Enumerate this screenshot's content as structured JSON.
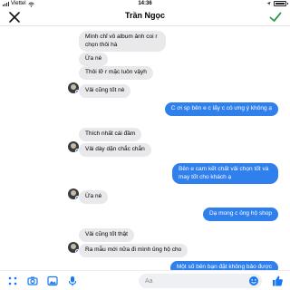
{
  "status_bar": {
    "carrier": "Viettel",
    "time": "14:36",
    "battery_level": 0.8
  },
  "header": {
    "title": "Trần Ngọc"
  },
  "messages": [
    {
      "sender": "contact",
      "text": "Mình chỉ vô album ảnh coi r chọn thôi hà"
    },
    {
      "sender": "contact",
      "text": "Ừa nè"
    },
    {
      "sender": "contact",
      "text": "Thôi lỡ r mặc luôn vậyh"
    },
    {
      "sender": "contact",
      "text": "Vải cũng tốt nè"
    },
    {
      "sender": "me",
      "text": "C ơi sp bên e c lấy c có ưng ý không ạ"
    },
    {
      "sender": "contact",
      "text": "Thích nhất cái đầm"
    },
    {
      "sender": "contact",
      "text": "Vải dày dặn chắc chắn"
    },
    {
      "sender": "me",
      "text": "Bên e cam kết chất vải chọn tốt và may tốt cho khách ạ"
    },
    {
      "sender": "contact",
      "text": "Ừa nè"
    },
    {
      "sender": "me",
      "text": "Dạ mong c ủng hộ shop"
    },
    {
      "sender": "contact",
      "text": "Vải cũng tốt thật"
    },
    {
      "sender": "contact",
      "text": "Ra mẫu mới nữa đi mình ủng hộ cho"
    },
    {
      "sender": "me",
      "text": "Một số bên bạn đặt không bảo được"
    }
  ],
  "composer": {
    "placeholder": "Aa"
  },
  "colors": {
    "outgoing_bubble": "#2f80ed",
    "incoming_bubble": "#e9e9eb",
    "icon_blue": "#1877f2",
    "check_green": "#2e9c4a"
  }
}
